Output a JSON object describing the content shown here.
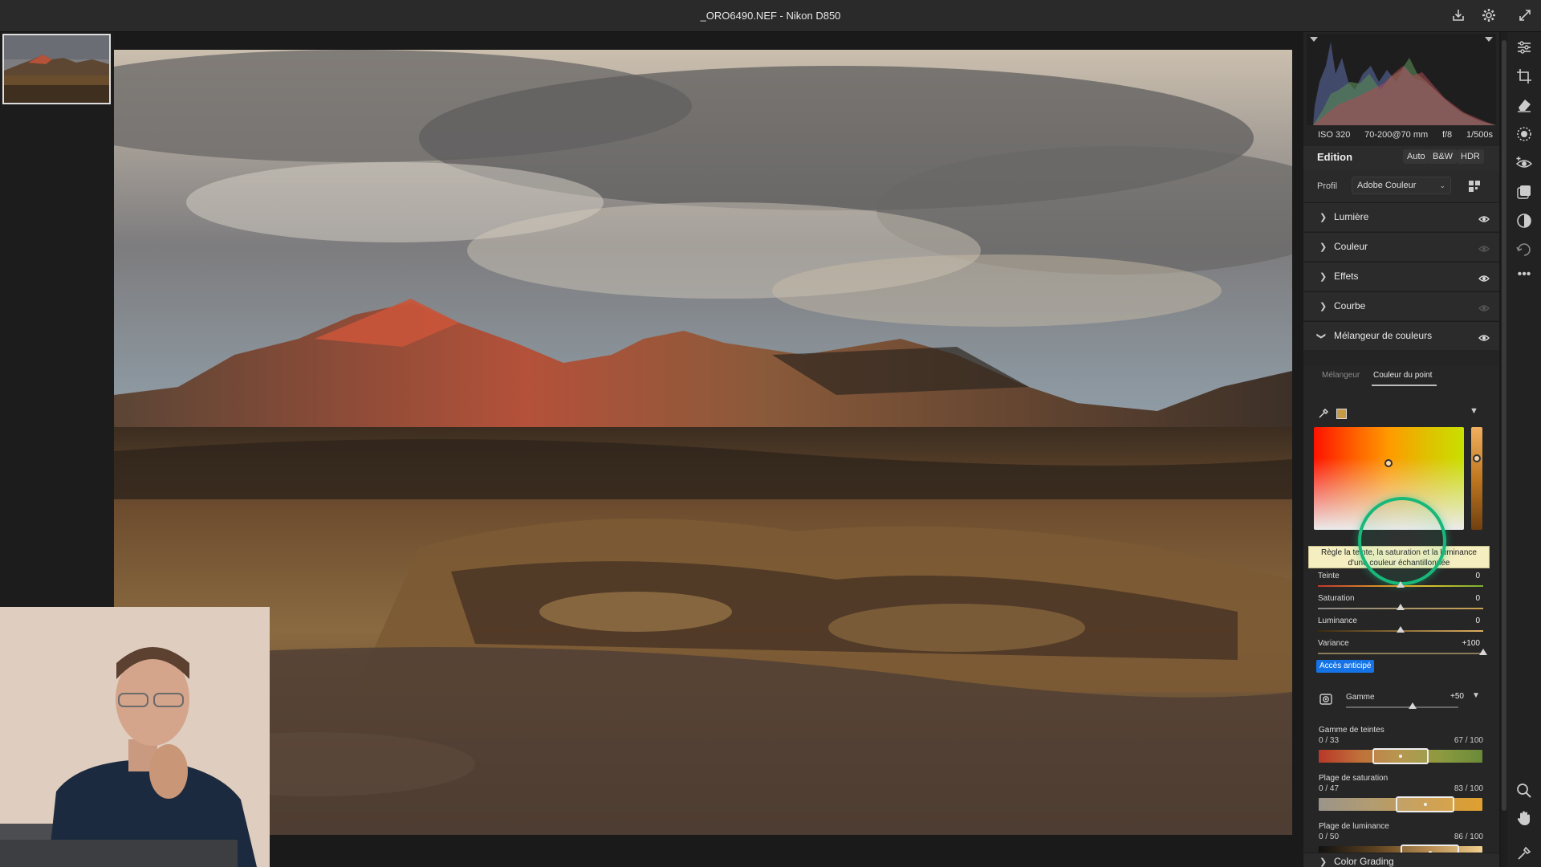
{
  "window": {
    "title": "_ORO6490.NEF  -  Nikon D850"
  },
  "titlebar_icons": [
    "export-icon",
    "settings-icon",
    "fullscreen-icon"
  ],
  "exif": {
    "iso": "ISO 320",
    "lens": "70-200@70 mm",
    "aperture": "f/8",
    "shutter": "1/500s"
  },
  "edit": {
    "title": "Edition",
    "buttons": [
      "Auto",
      "B&W",
      "HDR"
    ],
    "profile_label": "Profil",
    "profile_value": "Adobe Couleur"
  },
  "sections": [
    {
      "name": "Lumière",
      "visible": true
    },
    {
      "name": "Couleur",
      "visible": false
    },
    {
      "name": "Effets",
      "visible": true
    },
    {
      "name": "Courbe",
      "visible": false
    }
  ],
  "mixer": {
    "title": "Mélangeur de couleurs",
    "tabs": [
      "Mélangeur",
      "Couleur du point"
    ],
    "active_tab": 1,
    "swatch_color": "#c79a45",
    "tooltip_line1": "Règle la teinte, la saturation et la luminance",
    "tooltip_line2": "d'une couleur échantillonnée",
    "sliders": [
      {
        "name": "Teinte",
        "value": "0",
        "pos": 0.5
      },
      {
        "name": "Saturation",
        "value": "0",
        "pos": 0.5
      },
      {
        "name": "Luminance",
        "value": "0",
        "pos": 0.5
      },
      {
        "name": "Variance",
        "value": "+100",
        "pos": 1.0
      }
    ],
    "early_access": "Accès anticipé",
    "range": {
      "name": "Gamme",
      "value": "+50",
      "pos": 0.55
    },
    "ranges": [
      {
        "title": "Gamme de teintes",
        "lo": "0 / 33",
        "hi": "67 / 100",
        "sel": [
          0.33,
          0.67
        ]
      },
      {
        "title": "Plage de saturation",
        "lo": "0 / 47",
        "hi": "83 / 100",
        "sel": [
          0.47,
          0.83
        ]
      },
      {
        "title": "Plage de luminance",
        "lo": "0 / 50",
        "hi": "86 / 100",
        "sel": [
          0.5,
          0.86
        ]
      }
    ]
  },
  "color_grading": {
    "name": "Color Grading"
  },
  "toolbar": [
    "edit-sliders-icon",
    "crop-icon",
    "eraser-icon",
    "masking-icon",
    "redeye-icon",
    "presets-icon",
    "enhance-icon",
    "history-icon",
    "more-icon"
  ],
  "bottom_tools": [
    "zoom-icon",
    "hand-icon",
    "sample-icon"
  ]
}
